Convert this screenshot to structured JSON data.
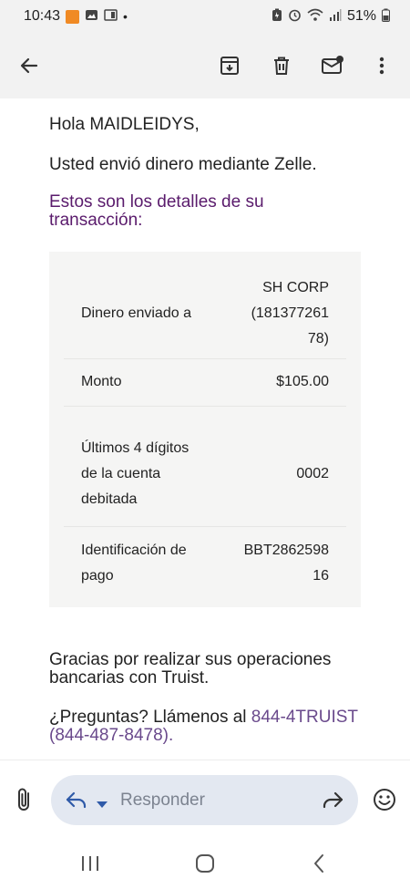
{
  "status_bar": {
    "time": "10:43",
    "dot": "•",
    "battery": "51%",
    "left_icons": [
      "app-notification-icon",
      "gallery-icon",
      "screen-icon"
    ],
    "right_icons": [
      "battery-saver-icon",
      "alarm-icon",
      "wifi-icon",
      "signal-icon",
      "battery-icon"
    ]
  },
  "toolbar": {
    "icons": [
      "back-arrow-icon",
      "archive-icon",
      "delete-icon",
      "mark-unread-icon",
      "more-vert-icon"
    ]
  },
  "email": {
    "greeting": "Hola MAIDLEIDYS,",
    "sent_text": "Usted envió dinero mediante Zelle.",
    "details_heading": "Estos son los detalles de su transacción:",
    "rows": [
      {
        "label": "Dinero enviado a",
        "value_lines": [
          "SH CORP",
          "(181377261",
          "78)"
        ]
      },
      {
        "label": "Monto",
        "value_lines": [
          "$105.00"
        ]
      },
      {
        "label_lines": [
          "Últimos 4 dígitos",
          "de la cuenta",
          "debitada"
        ],
        "value_lines": [
          "0002"
        ]
      },
      {
        "label_lines": [
          "Identificación de",
          "pago"
        ],
        "value_lines": [
          "BBT2862598",
          "16"
        ]
      }
    ],
    "thanks": "Gracias por realizar sus operaciones bancarias con Truist.",
    "questions_prefix": "¿Preguntas? Llámenos al ",
    "phone_link": "844-4TRUIST (844-487-8478)",
    "questions_suffix": "."
  },
  "reply": {
    "placeholder": "Responder",
    "icons": [
      "attach-icon",
      "reply-icon",
      "dropdown-icon",
      "forward-icon",
      "emoji-icon"
    ]
  },
  "nav": {
    "icons": [
      "recents-icon",
      "home-icon",
      "back-icon"
    ]
  },
  "colors": {
    "heading_purple": "#5a1b6c",
    "link_purple": "#6a4a8c",
    "card_bg": "#f5f5f4",
    "reply_pill": "#e3e8f1"
  }
}
